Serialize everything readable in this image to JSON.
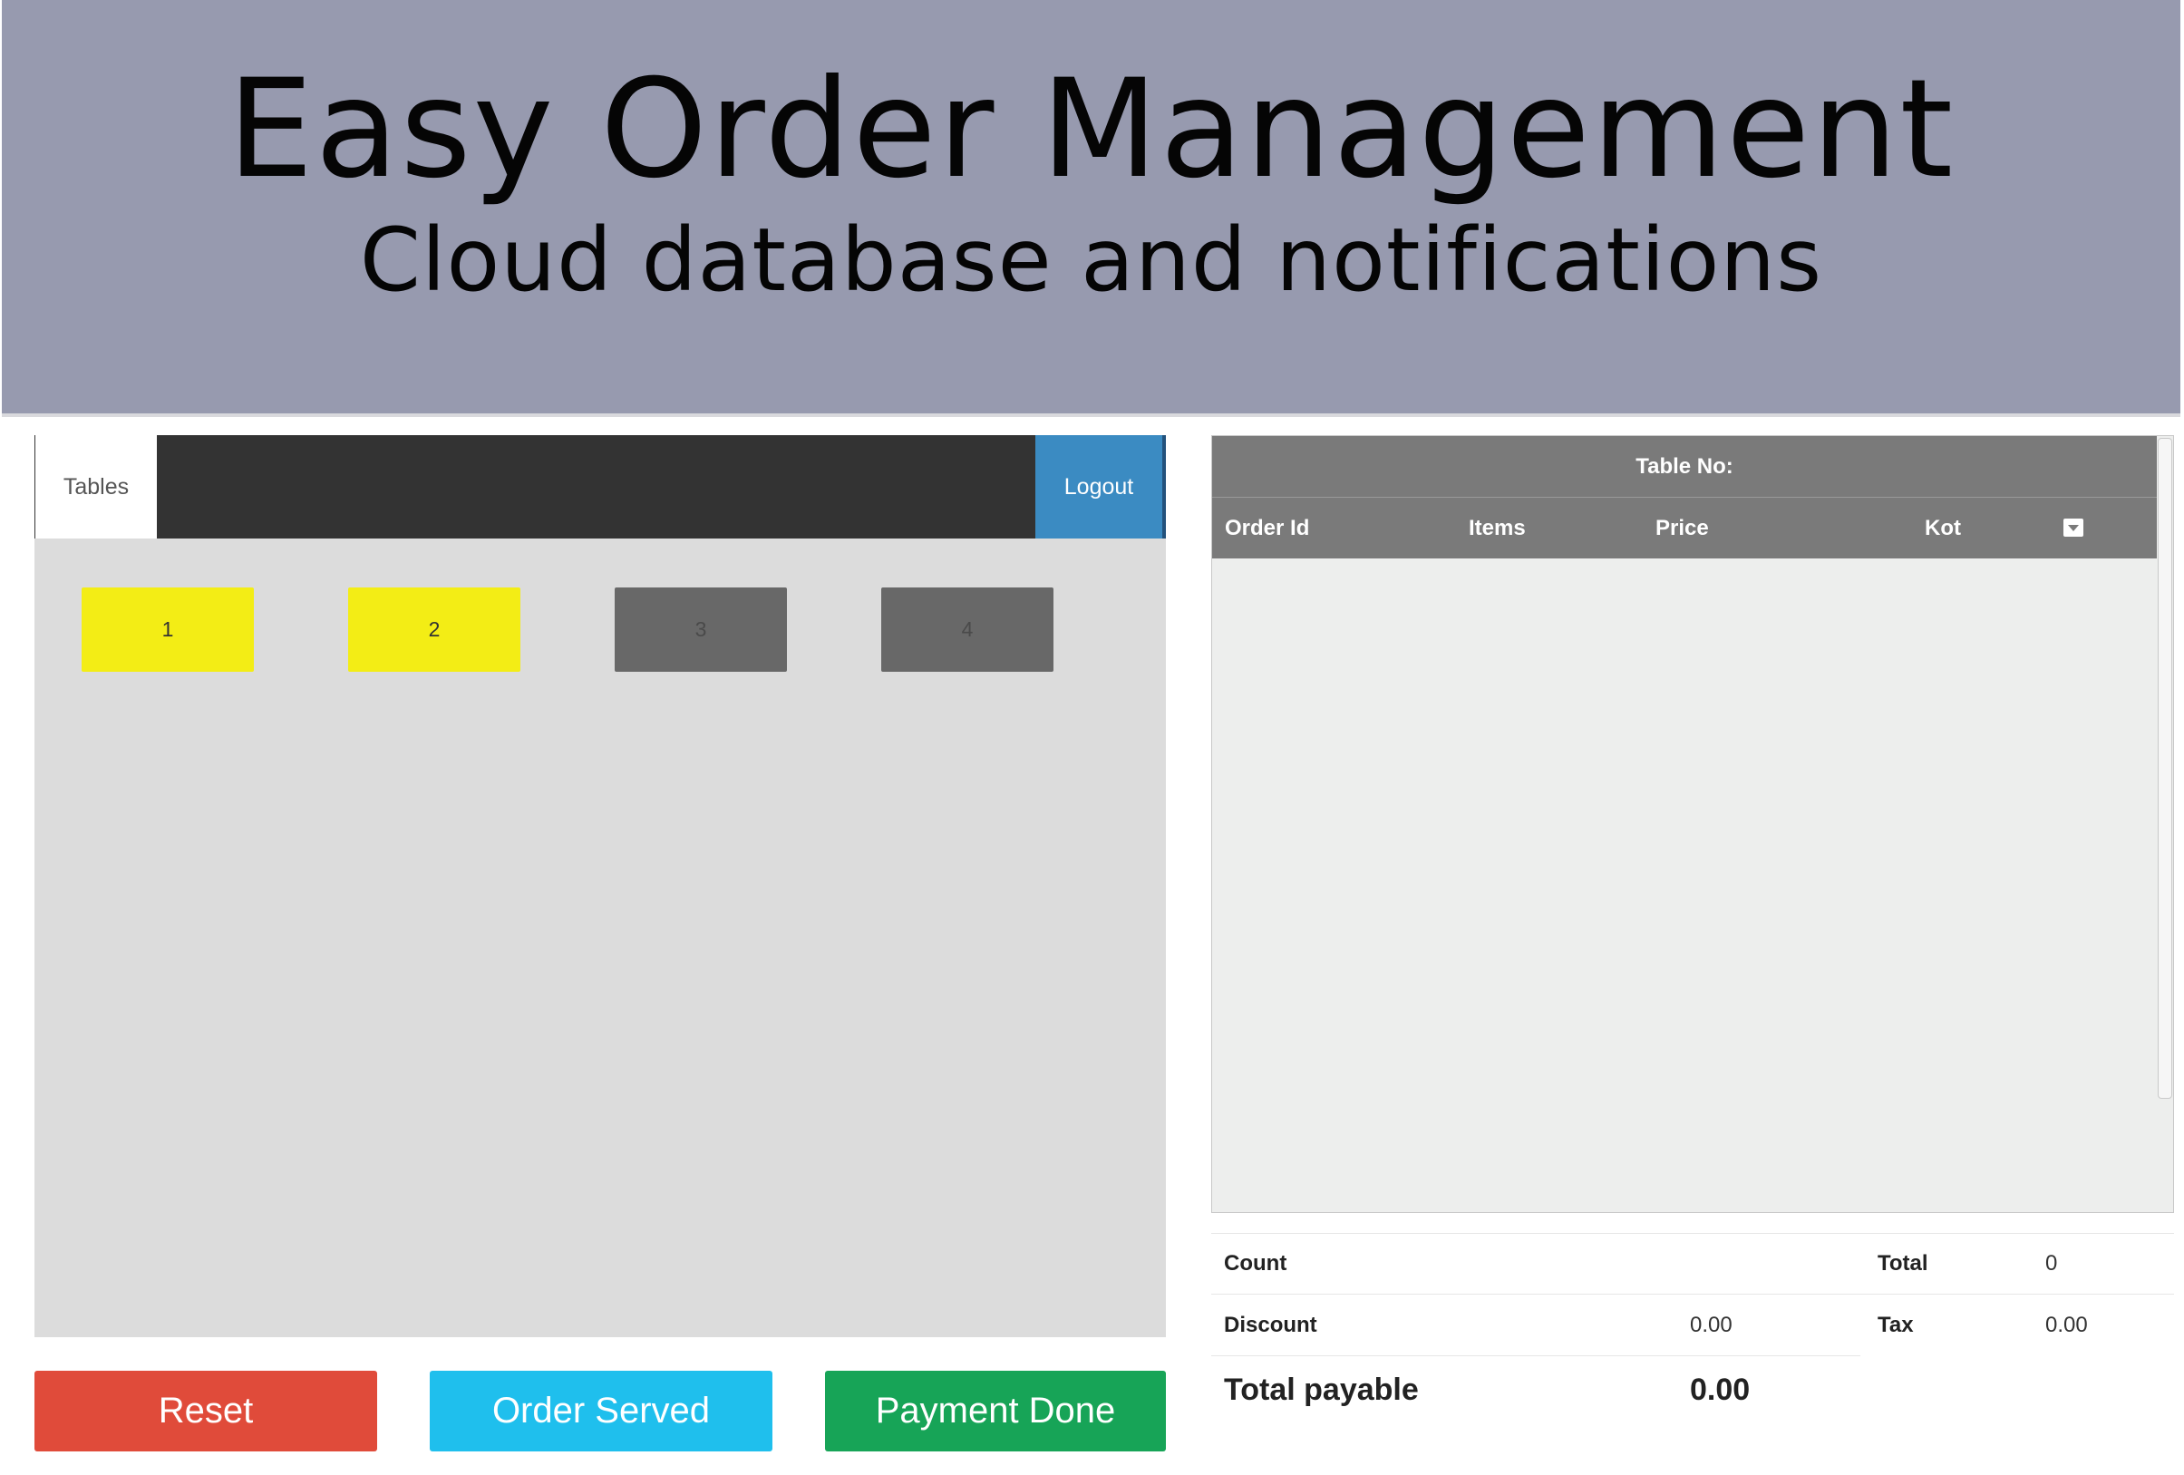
{
  "banner": {
    "title": "Easy Order Management",
    "subtitle": "Cloud database and notifications",
    "background": "#979aaf"
  },
  "nav": {
    "tables_tab": "Tables",
    "logout_label": "Logout"
  },
  "tables": [
    {
      "label": "1",
      "status": "occupied",
      "color": "#f3ed15"
    },
    {
      "label": "2",
      "status": "occupied",
      "color": "#f3ed15"
    },
    {
      "label": "3",
      "status": "free",
      "color": "#686868"
    },
    {
      "label": "4",
      "status": "free",
      "color": "#686868"
    }
  ],
  "actions": {
    "reset": "Reset",
    "order_served": "Order Served",
    "payment_done": "Payment Done",
    "colors": {
      "reset": "#e04b3a",
      "order_served": "#1fbfed",
      "payment_done": "#17a457"
    }
  },
  "order_table": {
    "title": "Table No:",
    "columns": [
      "Order Id",
      "Items",
      "Price",
      "Kot"
    ],
    "filter_icon": "dropdown-filter-icon",
    "rows": []
  },
  "summary": {
    "count_label": "Count",
    "count_value": "",
    "total_label": "Total",
    "total_value": "0",
    "discount_label": "Discount",
    "discount_value": "0.00",
    "tax_label": "Tax",
    "tax_value": "0.00",
    "payable_label": "Total payable",
    "payable_value": "0.00"
  }
}
